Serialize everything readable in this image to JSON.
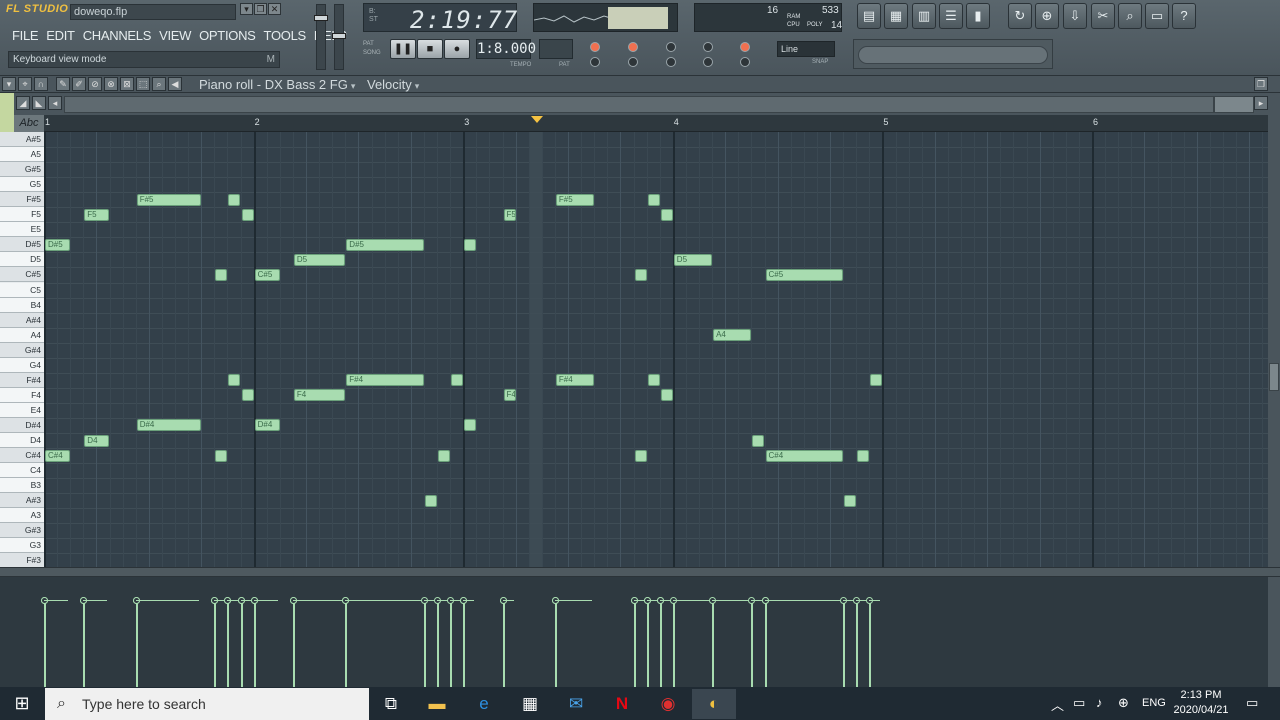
{
  "app": {
    "logo": "FL STUDIO",
    "filename": "doweqo.flp",
    "hint": "Keyboard view mode",
    "hint_key": "M"
  },
  "menu": [
    "FILE",
    "EDIT",
    "CHANNELS",
    "VIEW",
    "OPTIONS",
    "TOOLS",
    "HELP"
  ],
  "transport": {
    "time": "2:19:77",
    "pat_label": "PAT",
    "song_label": "SONG",
    "tempo": "1:8.000",
    "tempo_label": "TEMPO",
    "pat_box_label": "PAT",
    "snap": "Line",
    "snap_label": "SNAP"
  },
  "cpu": {
    "a": "16",
    "b": "533",
    "c": "14",
    "ram": "RAM",
    "cpu": "CPU",
    "poly": "POLY"
  },
  "piano_roll": {
    "title": "Piano roll - DX Bass 2 FG",
    "target": "Velocity",
    "abc": "Abc"
  },
  "ruler": [
    "1",
    "2",
    "3",
    "4",
    "5",
    "6"
  ],
  "keys": [
    "A#5",
    "A5",
    "G#5",
    "G5",
    "F#5",
    "F5",
    "E5",
    "D#5",
    "D5",
    "C#5",
    "C5",
    "B4",
    "A#4",
    "A4",
    "G#4",
    "G4",
    "F#4",
    "F4",
    "E4",
    "D#4",
    "D4",
    "C#4",
    "C4",
    "B3",
    "A#3",
    "A3",
    "G#3",
    "G3",
    "F#3"
  ],
  "notes": [
    {
      "pitch": "D#5",
      "start": 0.0,
      "len": 0.5,
      "label": "D#5"
    },
    {
      "pitch": "C#4",
      "start": 0.0,
      "len": 0.5,
      "label": "C#4"
    },
    {
      "pitch": "F5",
      "start": 0.75,
      "len": 0.5,
      "label": "F5"
    },
    {
      "pitch": "D4",
      "start": 0.75,
      "len": 0.5,
      "label": "D4"
    },
    {
      "pitch": "F#5",
      "start": 1.75,
      "len": 1.25,
      "label": "F#5"
    },
    {
      "pitch": "D#4",
      "start": 1.75,
      "len": 1.25,
      "label": "D#4"
    },
    {
      "pitch": "C#5",
      "start": 3.25,
      "len": 0.25,
      "label": ""
    },
    {
      "pitch": "C#4",
      "start": 3.25,
      "len": 0.25,
      "label": ""
    },
    {
      "pitch": "F#5",
      "start": 3.5,
      "len": 0.25,
      "label": ""
    },
    {
      "pitch": "F#4",
      "start": 3.5,
      "len": 0.25,
      "label": ""
    },
    {
      "pitch": "F5",
      "start": 3.75,
      "len": 0.25,
      "label": ""
    },
    {
      "pitch": "F4",
      "start": 3.75,
      "len": 0.25,
      "label": ""
    },
    {
      "pitch": "C#5",
      "start": 4.0,
      "len": 0.5,
      "label": "C#5"
    },
    {
      "pitch": "D#4",
      "start": 4.0,
      "len": 0.5,
      "label": "D#4"
    },
    {
      "pitch": "D5",
      "start": 4.75,
      "len": 1.0,
      "label": "D5"
    },
    {
      "pitch": "F4",
      "start": 4.75,
      "len": 1.0,
      "label": "F4"
    },
    {
      "pitch": "D#5",
      "start": 5.75,
      "len": 1.5,
      "label": "D#5"
    },
    {
      "pitch": "F#4",
      "start": 5.75,
      "len": 1.5,
      "label": "F#4"
    },
    {
      "pitch": "A#3",
      "start": 7.25,
      "len": 0.25,
      "label": ""
    },
    {
      "pitch": "C#4",
      "start": 7.5,
      "len": 0.25,
      "label": ""
    },
    {
      "pitch": "F#4",
      "start": 7.75,
      "len": 0.25,
      "label": ""
    },
    {
      "pitch": "D#5",
      "start": 8.0,
      "len": 0.25,
      "label": ""
    },
    {
      "pitch": "D#4",
      "start": 8.0,
      "len": 0.25,
      "label": ""
    },
    {
      "pitch": "F5",
      "start": 8.75,
      "len": 0.25,
      "label": "F5"
    },
    {
      "pitch": "F4",
      "start": 8.75,
      "len": 0.25,
      "label": "F4"
    },
    {
      "pitch": "F#5",
      "start": 9.75,
      "len": 0.75,
      "label": "F#5"
    },
    {
      "pitch": "F#4",
      "start": 9.75,
      "len": 0.75,
      "label": "F#4"
    },
    {
      "pitch": "C#5",
      "start": 11.25,
      "len": 0.25,
      "label": ""
    },
    {
      "pitch": "C#4",
      "start": 11.25,
      "len": 0.25,
      "label": ""
    },
    {
      "pitch": "F#5",
      "start": 11.5,
      "len": 0.25,
      "label": ""
    },
    {
      "pitch": "F#4",
      "start": 11.5,
      "len": 0.25,
      "label": ""
    },
    {
      "pitch": "F5",
      "start": 11.75,
      "len": 0.25,
      "label": ""
    },
    {
      "pitch": "F4",
      "start": 11.75,
      "len": 0.25,
      "label": ""
    },
    {
      "pitch": "D5",
      "start": 12.0,
      "len": 0.75,
      "label": "D5"
    },
    {
      "pitch": "A4",
      "start": 12.75,
      "len": 0.75,
      "label": "A4"
    },
    {
      "pitch": "D4",
      "start": 13.5,
      "len": 0.25,
      "label": ""
    },
    {
      "pitch": "C#5",
      "start": 13.75,
      "len": 1.5,
      "label": "C#5"
    },
    {
      "pitch": "C#4",
      "start": 13.75,
      "len": 1.5,
      "label": "C#4"
    },
    {
      "pitch": "A#3",
      "start": 15.25,
      "len": 0.25,
      "label": ""
    },
    {
      "pitch": "C#4",
      "start": 15.5,
      "len": 0.25,
      "label": ""
    },
    {
      "pitch": "F#4",
      "start": 15.75,
      "len": 0.25,
      "label": ""
    }
  ],
  "taskbar": {
    "search_placeholder": "Type here to search",
    "lang": "ENG",
    "time": "2:13 PM",
    "date": "2020/04/21"
  },
  "colors": {
    "note": "#a8dcb0",
    "grid": "#33404a",
    "playhead": "#f5c242"
  }
}
